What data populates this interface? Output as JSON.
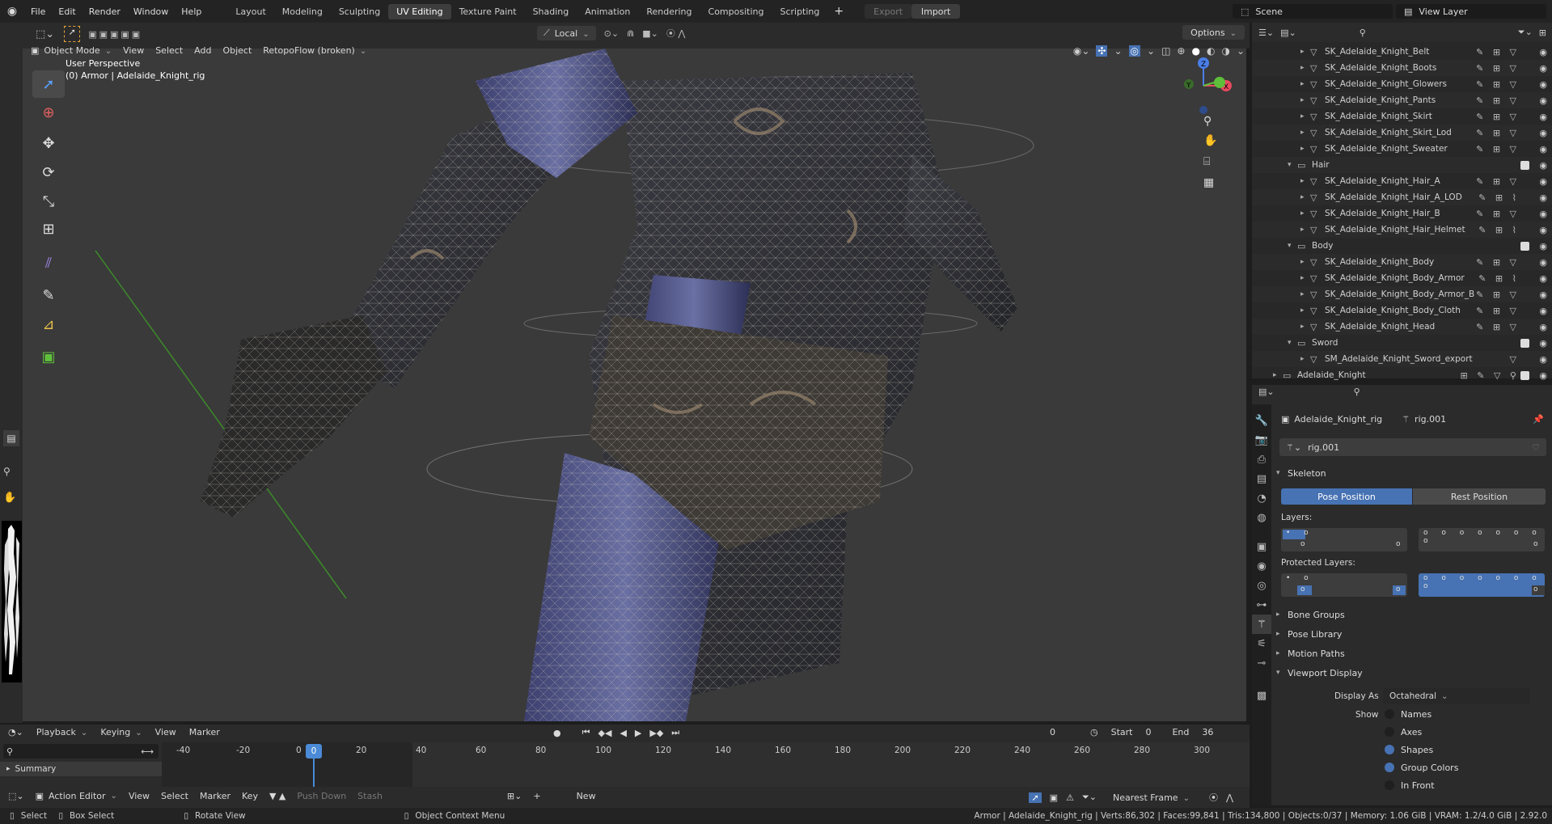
{
  "menu": {
    "file": "File",
    "edit": "Edit",
    "render": "Render",
    "window": "Window",
    "help": "Help"
  },
  "workspaces": [
    "Layout",
    "Modeling",
    "Sculpting",
    "UV Editing",
    "Texture Paint",
    "Shading",
    "Animation",
    "Rendering",
    "Compositing",
    "Scripting"
  ],
  "workspace_active": "UV Editing",
  "export_label": "Export",
  "import_label": "Import",
  "scene_name": "Scene",
  "view_layer": "View Layer",
  "viewport": {
    "mode": "Object Mode",
    "menus": {
      "view": "View",
      "select": "Select",
      "add": "Add",
      "object": "Object",
      "retopoflow": "RetopoFlow (broken)"
    },
    "transform_orientation": "Local",
    "options": "Options",
    "overlay_title": "User Perspective",
    "overlay_subtitle": "(0) Armor | Adelaide_Knight_rig"
  },
  "outliner": {
    "items": [
      {
        "name": "SK_Adelaide_Knight_Belt",
        "level": 2,
        "kind": "mesh",
        "mods": "✎ ⊞ ▽"
      },
      {
        "name": "SK_Adelaide_Knight_Boots",
        "level": 2,
        "kind": "mesh",
        "mods": "✎ ⊞ ▽"
      },
      {
        "name": "SK_Adelaide_Knight_Glowers",
        "level": 2,
        "kind": "mesh",
        "mods": "✎ ⊞ ▽"
      },
      {
        "name": "SK_Adelaide_Knight_Pants",
        "level": 2,
        "kind": "mesh",
        "mods": "✎ ⊞ ▽"
      },
      {
        "name": "SK_Adelaide_Knight_Skirt",
        "level": 2,
        "kind": "mesh",
        "mods": "✎ ⊞ ▽"
      },
      {
        "name": "SK_Adelaide_Knight_Skirt_Lod",
        "level": 2,
        "kind": "mesh",
        "mods": "✎ ⊞ ▽"
      },
      {
        "name": "SK_Adelaide_Knight_Sweater",
        "level": 2,
        "kind": "mesh",
        "mods": "✎ ⊞ ▽"
      },
      {
        "name": "Hair",
        "level": 1,
        "kind": "collection",
        "mods": ""
      },
      {
        "name": "SK_Adelaide_Knight_Hair_A",
        "level": 2,
        "kind": "mesh",
        "mods": "✎ ⊞ ▽"
      },
      {
        "name": "SK_Adelaide_Knight_Hair_A_LOD",
        "level": 2,
        "kind": "mesh",
        "mods": "✎ ⊞ ⌇"
      },
      {
        "name": "SK_Adelaide_Knight_Hair_B",
        "level": 2,
        "kind": "mesh",
        "mods": "✎ ⊞ ▽"
      },
      {
        "name": "SK_Adelaide_Knight_Hair_Helmet",
        "level": 2,
        "kind": "mesh",
        "mods": "✎ ⊞ ⌇"
      },
      {
        "name": "Body",
        "level": 1,
        "kind": "collection",
        "mods": ""
      },
      {
        "name": "SK_Adelaide_Knight_Body",
        "level": 2,
        "kind": "mesh",
        "mods": "✎ ⊞ ▽"
      },
      {
        "name": "SK_Adelaide_Knight_Body_Armor",
        "level": 2,
        "kind": "mesh",
        "mods": "✎ ⊞ ⌇"
      },
      {
        "name": "SK_Adelaide_Knight_Body_Armor_B",
        "level": 2,
        "kind": "mesh",
        "mods": "✎ ⊞ ▽"
      },
      {
        "name": "SK_Adelaide_Knight_Body_Cloth",
        "level": 2,
        "kind": "mesh",
        "mods": "✎ ⊞ ▽"
      },
      {
        "name": "SK_Adelaide_Knight_Head",
        "level": 2,
        "kind": "mesh",
        "mods": "✎ ⊞ ▽"
      },
      {
        "name": "Sword",
        "level": 1,
        "kind": "collection",
        "mods": ""
      },
      {
        "name": "SM_Adelaide_Knight_Sword_export",
        "level": 2,
        "kind": "mesh",
        "mods": "▽"
      },
      {
        "name": "Adelaide_Knight",
        "level": 0,
        "kind": "collection",
        "mods": "⊞ ✎ ▽ ⚲"
      }
    ]
  },
  "properties": {
    "object_name": "Adelaide_Knight_rig",
    "armature_name": "rig.001",
    "data_field": "rig.001",
    "skeleton": "Skeleton",
    "pose_position": "Pose Position",
    "rest_position": "Rest Position",
    "layers": "Layers:",
    "protected_layers": "Protected Layers:",
    "bone_groups": "Bone Groups",
    "pose_library": "Pose Library",
    "motion_paths": "Motion Paths",
    "viewport_display": "Viewport Display",
    "display_as_label": "Display As",
    "display_as_value": "Octahedral",
    "show_label": "Show",
    "show_items": [
      {
        "label": "Names",
        "on": false
      },
      {
        "label": "Axes",
        "on": false
      },
      {
        "label": "Shapes",
        "on": true
      },
      {
        "label": "Group Colors",
        "on": true
      },
      {
        "label": "In Front",
        "on": false
      }
    ]
  },
  "timeline": {
    "playback": "Playback",
    "keying": "Keying",
    "view": "View",
    "marker": "Marker",
    "current_frame": "0",
    "start_label": "Start",
    "start": "0",
    "end_label": "End",
    "end": "36",
    "ruler": [
      "-40",
      "-20",
      "0",
      "20",
      "40",
      "60",
      "80",
      "100",
      "120",
      "140",
      "160",
      "180",
      "200",
      "220",
      "240",
      "260",
      "280",
      "300"
    ],
    "summary": "Summary"
  },
  "action_editor": {
    "mode": "Action Editor",
    "view": "View",
    "select": "Select",
    "marker": "Marker",
    "key": "Key",
    "push_down": "Push Down",
    "stash": "Stash",
    "new": "New",
    "snap": "Nearest Frame"
  },
  "status": {
    "select": "Select",
    "box_select": "Box Select",
    "rotate_view": "Rotate View",
    "context_menu": "Object Context Menu",
    "stats": "Armor | Adelaide_Knight_rig | Verts:86,302 | Faces:99,841 | Tris:134,800 | Objects:0/37 | Memory: 1.06 GiB | VRAM: 1.2/4.0 GiB | 2.92.0"
  },
  "colors": {
    "accent": "#4772b3",
    "playhead": "#4a8ad6",
    "axis_x": "#e84a5f",
    "axis_y": "#5fbf3a",
    "axis_z": "#4a7ee8"
  }
}
